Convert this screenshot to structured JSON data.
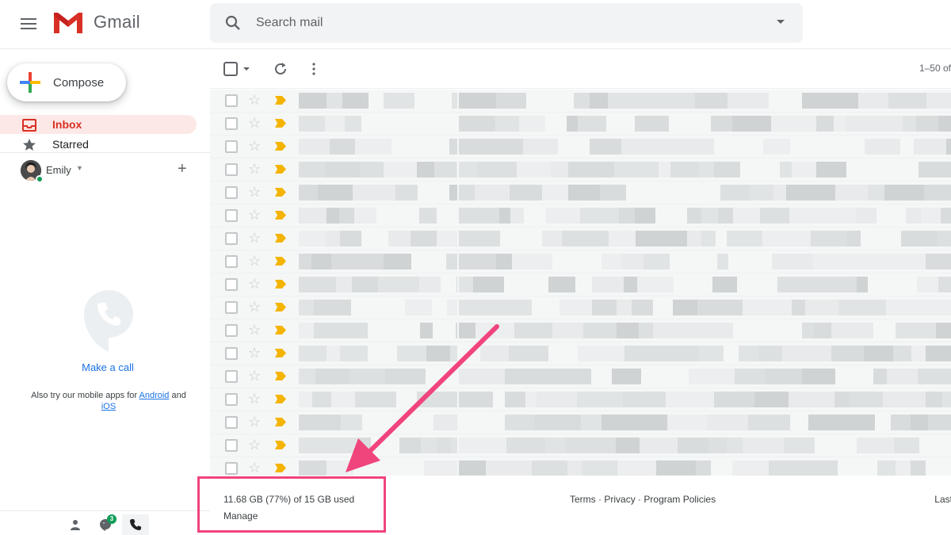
{
  "header": {
    "app_name": "Gmail",
    "search_placeholder": "Search mail"
  },
  "sidebar": {
    "compose_label": "Compose",
    "items": [
      {
        "label": "Inbox",
        "icon": "inbox-icon",
        "active": true
      },
      {
        "label": "Starred",
        "icon": "star-icon",
        "active": false
      }
    ],
    "hangouts_user": "Emily",
    "make_call": "Make a call",
    "apps_note_prefix": "Also try our mobile apps for",
    "apps_note_android": "Android",
    "apps_note_and": "and",
    "apps_note_ios": "iOS",
    "chat_badge": "3"
  },
  "toolbar": {
    "pagination": "1–50 of"
  },
  "email_rows": 17,
  "footer": {
    "storage": "11.68 GB (77%) of 15 GB used",
    "storage_used_gb": 11.68,
    "storage_total_gb": 15,
    "storage_percent": 77,
    "manage": "Manage",
    "terms": "Terms",
    "privacy": "Privacy",
    "program_policies": "Program Policies",
    "separator": "·",
    "last_activity": "Last a"
  },
  "colors": {
    "inbox_active": "#d93025",
    "inbox_active_bg": "#fce8e6",
    "link": "#1a73e8",
    "annotation": "#f0447c",
    "important_marker": "#f4b400"
  }
}
